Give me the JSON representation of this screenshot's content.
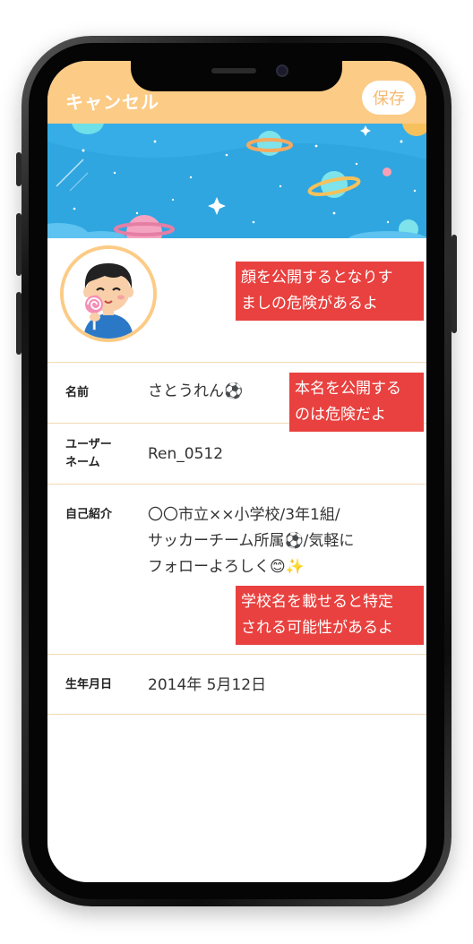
{
  "header": {
    "cancel_label": "キャンセル",
    "save_label": "保存"
  },
  "profile": {
    "avatar_icon": "boy-with-lollipop-avatar"
  },
  "fields": {
    "name": {
      "label": "名前",
      "value": "さとうれん⚽"
    },
    "username": {
      "label_line1": "ユーザー",
      "label_line2": "ネーム",
      "value": "Ren_0512"
    },
    "bio": {
      "label": "自己紹介",
      "line1": "〇〇市立××小学校/3年1組/",
      "line2": "サッカーチーム所属⚽/気軽に",
      "line3": "フォローよろしく😊✨"
    },
    "birthday": {
      "label": "生年月日",
      "value": "2014年 5月12日"
    }
  },
  "warnings": {
    "face": {
      "line1": "顔を公開するとなりす",
      "line2": "ましの危険があるよ"
    },
    "real_name": {
      "line1": "本名を公開する",
      "line2": "のは危険だよ"
    },
    "school": {
      "line1": "学校名を載せると特定",
      "line2": "される可能性があるよ"
    }
  },
  "colors": {
    "accent": "#fccb85",
    "warning": "#e8413f",
    "banner": "#2fa6e0"
  }
}
